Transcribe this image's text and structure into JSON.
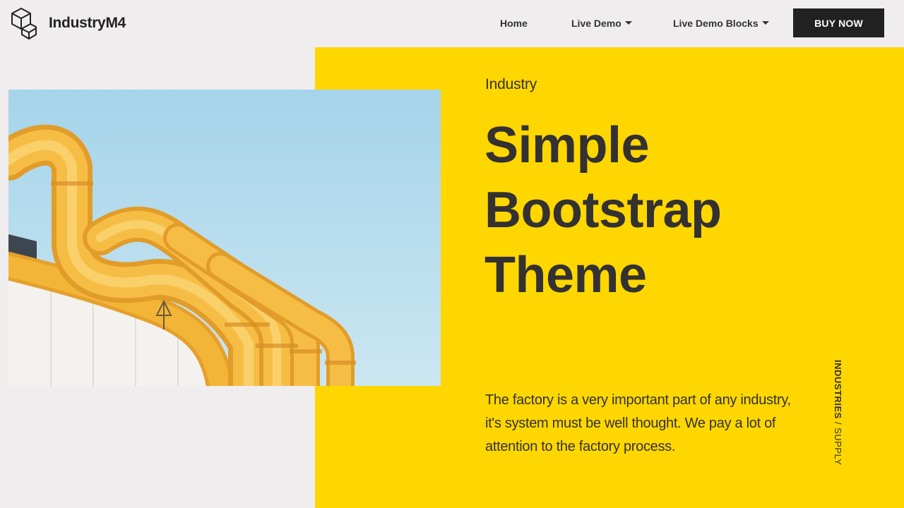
{
  "brand": {
    "name": "IndustryM4",
    "icon": "cubes-logo-icon"
  },
  "nav": {
    "items": [
      {
        "label": "Home",
        "has_dropdown": false
      },
      {
        "label": "Live Demo",
        "has_dropdown": true
      },
      {
        "label": "Live Demo Blocks",
        "has_dropdown": true
      }
    ],
    "cta_label": "BUY NOW"
  },
  "hero": {
    "eyebrow": "Industry",
    "headline_lines": [
      "Simple",
      "Bootstrap",
      "Theme"
    ],
    "lead": "The factory is a very important part of any industry, it's system must be well thought. We pay a lot of attention to the factory process.",
    "vertical_tag": {
      "strong": "INDUSTRIES",
      "separator": " / ",
      "light": "SUPPLY"
    },
    "photo": "yellow-industrial-pipes-photo"
  },
  "colors": {
    "accent_yellow": "#ffd700",
    "background": "#efeded",
    "dark": "#212121",
    "text": "#333131",
    "sky": "#aed8ec",
    "pipe": "#f3b537"
  }
}
